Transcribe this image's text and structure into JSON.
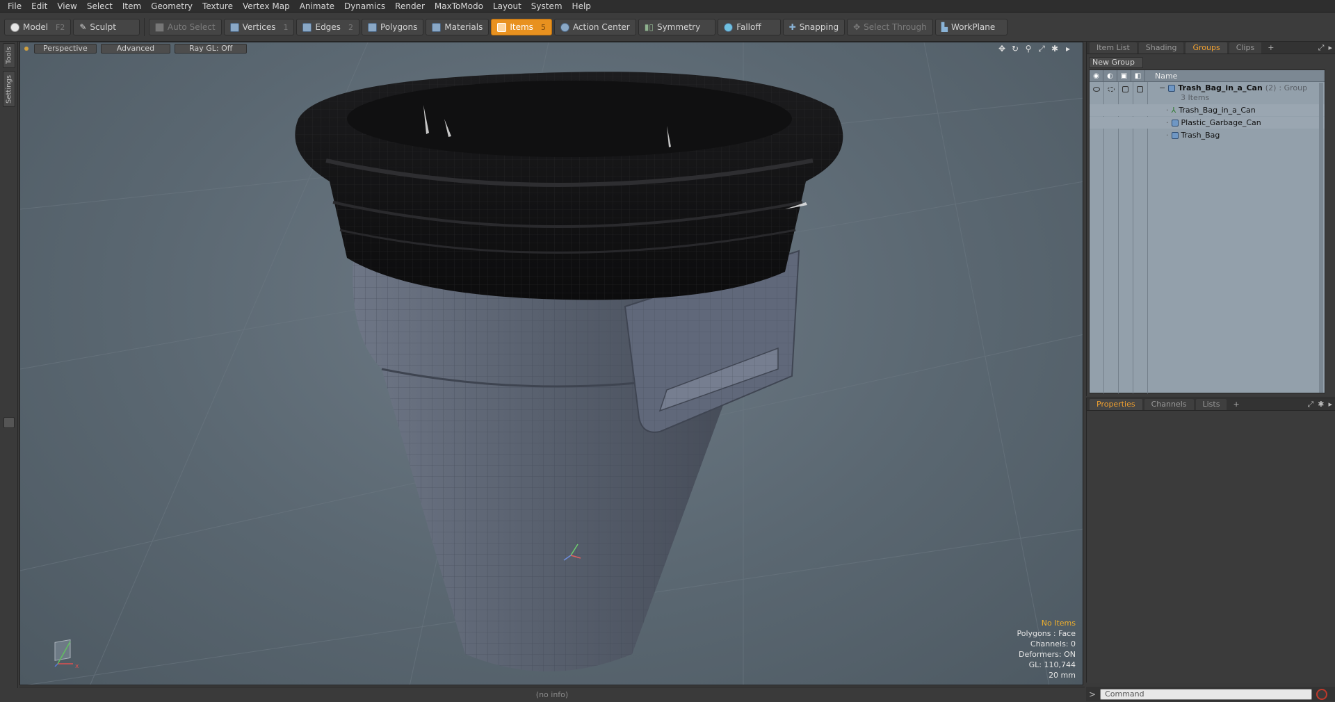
{
  "menu": [
    "File",
    "Edit",
    "View",
    "Select",
    "Item",
    "Geometry",
    "Texture",
    "Vertex Map",
    "Animate",
    "Dynamics",
    "Render",
    "MaxToModo",
    "Layout",
    "System",
    "Help"
  ],
  "toolbar": {
    "model": "Model",
    "model_key": "F2",
    "sculpt": "Sculpt",
    "auto_select": "Auto Select",
    "vertices": "Vertices",
    "vertices_key": "1",
    "edges": "Edges",
    "edges_key": "2",
    "polygons": "Polygons",
    "materials": "Materials",
    "items": "Items",
    "items_key": "5",
    "action_center": "Action Center",
    "symmetry": "Symmetry",
    "falloff": "Falloff",
    "snapping": "Snapping",
    "select_through": "Select Through",
    "workplane": "WorkPlane"
  },
  "left_tabs": [
    "Tools",
    "Settings"
  ],
  "viewport": {
    "view_mode": "Perspective",
    "shading": "Advanced",
    "raygl": "Ray GL: Off",
    "info": {
      "selection": "No Items",
      "polygons": "Polygons : Face",
      "channels": "Channels: 0",
      "deformers": "Deformers: ON",
      "gl": "GL: 110,744",
      "grid": "20 mm"
    }
  },
  "status": "(no info)",
  "groups_panel": {
    "tabs": [
      "Item List",
      "Shading",
      "Groups",
      "Clips"
    ],
    "active_tab": "Groups",
    "new_group": "New Group",
    "column_name": "Name",
    "group": {
      "name": "Trash_Bag_in_a_Can",
      "count": "(2)",
      "type": ": Group",
      "subtitle": "3 Items"
    },
    "children": [
      "Trash_Bag_in_a_Can",
      "Plastic_Garbage_Can",
      "Trash_Bag"
    ]
  },
  "properties_panel": {
    "tabs": [
      "Properties",
      "Channels",
      "Lists"
    ],
    "active_tab": "Properties"
  },
  "command": {
    "placeholder": "Command",
    "prompt": ">"
  },
  "colors": {
    "accent": "#e8911f",
    "viewport_bg": "#5a6771",
    "groups_bg": "#93a0ab"
  }
}
